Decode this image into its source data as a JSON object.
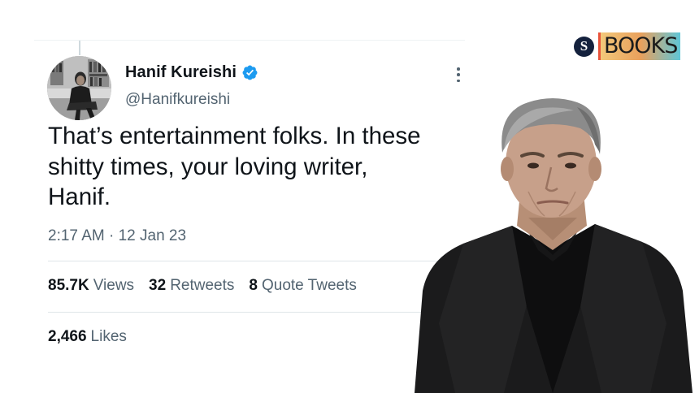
{
  "tweet": {
    "display_name": "Hanif Kureishi",
    "handle": "@Hanifkureishi",
    "text": "That’s entertainment folks. In these\nshitty times, your loving writer,\nHanif.",
    "timestamp": "2:17 AM · 12 Jan 23",
    "views_count": "85.7K",
    "views_label": "Views",
    "retweets_count": "32",
    "retweets_label": "Retweets",
    "quotes_count": "8",
    "quotes_label": "Quote Tweets",
    "likes_count": "2,466",
    "likes_label": "Likes",
    "verified_icon": "verified-badge-icon",
    "more_icon": "more-options-icon"
  },
  "brand": {
    "icon_letter": "S",
    "word": "BOOKS"
  },
  "colors": {
    "text_primary": "#0f1419",
    "text_secondary": "#536471",
    "verified_blue": "#1d9bf0",
    "divider": "#dfe5e8"
  }
}
